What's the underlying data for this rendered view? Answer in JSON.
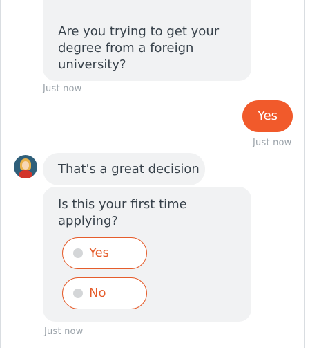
{
  "messages": {
    "bot_question_1": "Are you trying to get your degree from a foreign university?",
    "timestamp_1": "Just now",
    "user_reply": "Yes",
    "timestamp_2": "Just now",
    "bot_reply_1": "That's a great decision",
    "bot_question_2": "Is this your first time applying?",
    "options": [
      "Yes",
      "No"
    ],
    "timestamp_3": "Just now"
  },
  "colors": {
    "accent": "#f15a2b",
    "option_border": "#e55d2c",
    "bubble_bg": "#f1f2f3",
    "timestamp": "#9aa2a9"
  },
  "icons": {
    "avatar": "bot-avatar",
    "card_image": "illustration"
  }
}
